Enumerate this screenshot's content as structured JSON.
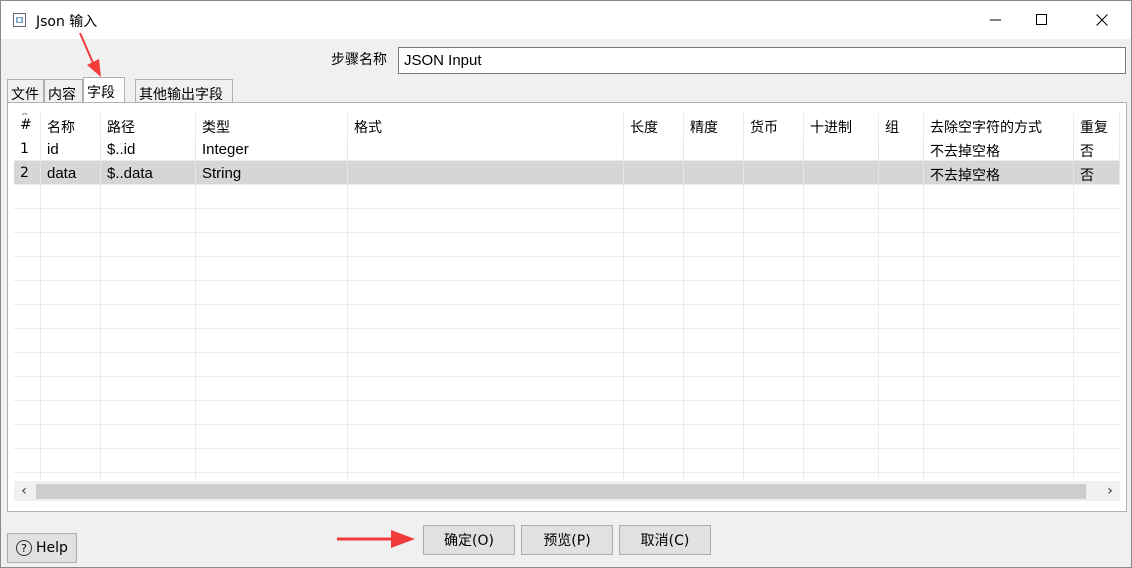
{
  "window": {
    "title": "Json 输入",
    "controls": [
      "minimize",
      "maximize",
      "close"
    ]
  },
  "step_name": {
    "label": "步骤名称",
    "value": "JSON Input"
  },
  "tabs": [
    {
      "label": "文件",
      "active": false
    },
    {
      "label": "内容",
      "active": false
    },
    {
      "label": "字段",
      "active": true
    },
    {
      "label": "其他输出字段",
      "active": false
    }
  ],
  "fields_table": {
    "columns": [
      "#",
      "名称",
      "路径",
      "类型",
      "格式",
      "长度",
      "精度",
      "货币",
      "十进制",
      "组",
      "去除空字符的方式",
      "重复"
    ],
    "rows": [
      {
        "num": "1",
        "name": "id",
        "path": "$..id",
        "type": "Integer",
        "format": "",
        "length": "",
        "precision": "",
        "currency": "",
        "decimal": "",
        "group": "",
        "trim": "不去掉空格",
        "repeat": "否",
        "selected": false
      },
      {
        "num": "2",
        "name": "data",
        "path": "$..data",
        "type": "String",
        "format": "",
        "length": "",
        "precision": "",
        "currency": "",
        "decimal": "",
        "group": "",
        "trim": "不去掉空格",
        "repeat": "否",
        "selected": true
      }
    ]
  },
  "buttons": {
    "help": "Help",
    "ok": "确定(O)",
    "preview": "预览(P)",
    "cancel": "取消(C)"
  },
  "colors": {
    "annotation_arrow": "#f23b3b",
    "selected_row": "#d6d6d6"
  }
}
